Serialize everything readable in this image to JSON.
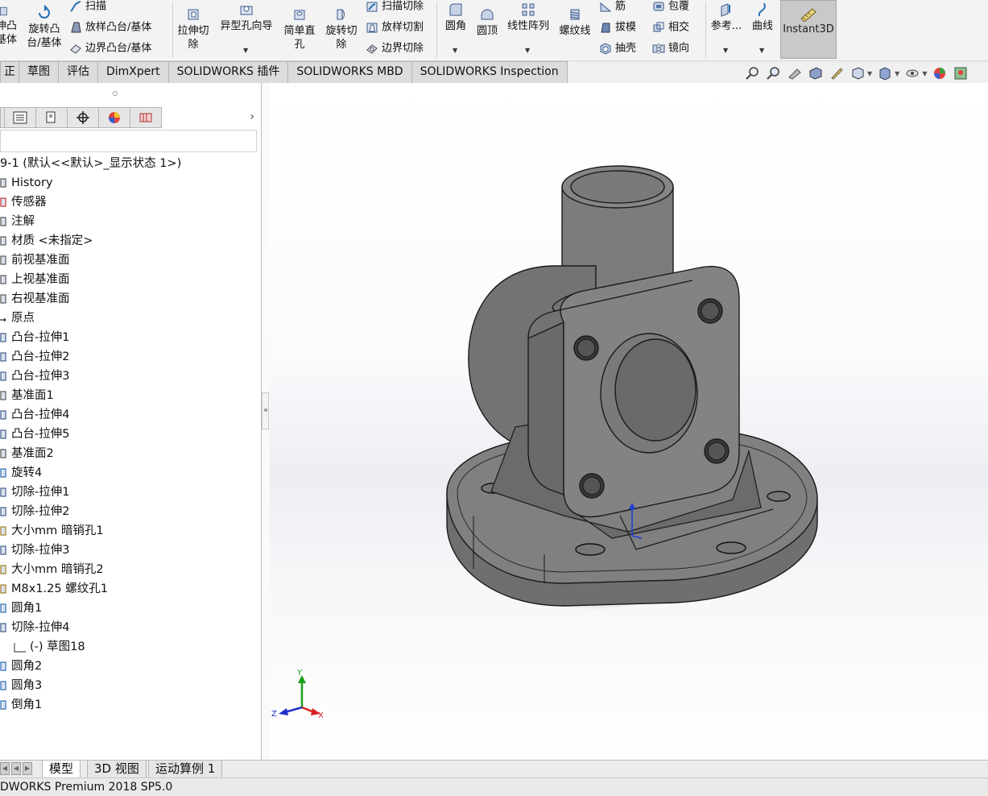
{
  "ribbon": {
    "col1": [
      "伸凸",
      "基体"
    ],
    "revolve_boss": [
      "旋转凸",
      "台/基体"
    ],
    "sweep": "扫描",
    "loft_boss": "放样凸台/基体",
    "boundary_boss": "边界凸台/基体",
    "extruded_cut": [
      "拉伸切",
      "除"
    ],
    "hole_wizard": "异型孔向导",
    "simple_hole": [
      "简单直",
      "孔"
    ],
    "revolved_cut": [
      "旋转切",
      "除"
    ],
    "swept_cut": "扫描切除",
    "lofted_cut": "放样切割",
    "boundary_cut": "边界切除",
    "fillet": "圆角",
    "dome": "圆顶",
    "linear_pattern": "线性阵列",
    "thread": "螺纹线",
    "rib": "筋",
    "draft": "拔模",
    "shell": "抽壳",
    "wrap": "包覆",
    "intersect": "相交",
    "mirror": "镜向",
    "reference": "参考...",
    "curves": "曲线",
    "instant3d": "Instant3D"
  },
  "tabs": [
    "正",
    "草图",
    "评估",
    "DimXpert",
    "SOLIDWORKS 插件",
    "SOLIDWORKS MBD",
    "SOLIDWORKS Inspection"
  ],
  "tree": {
    "root": "9-1  (默认<<默认>_显示状态 1>)",
    "items": [
      {
        "label": "History",
        "icon": "history-icon"
      },
      {
        "label": "传感器",
        "icon": "sensor-icon"
      },
      {
        "label": "注解",
        "icon": "annotation-icon"
      },
      {
        "label": "材质 <未指定>",
        "icon": "material-icon"
      },
      {
        "label": "前视基准面",
        "icon": "plane-icon"
      },
      {
        "label": "上视基准面",
        "icon": "plane-icon"
      },
      {
        "label": "右视基准面",
        "icon": "plane-icon"
      },
      {
        "label": "原点",
        "icon": "origin-icon"
      },
      {
        "label": "凸台-拉伸1",
        "icon": "extrude-icon"
      },
      {
        "label": "凸台-拉伸2",
        "icon": "extrude-icon"
      },
      {
        "label": "凸台-拉伸3",
        "icon": "extrude-icon"
      },
      {
        "label": "基准面1",
        "icon": "plane-icon"
      },
      {
        "label": "凸台-拉伸4",
        "icon": "extrude-icon"
      },
      {
        "label": "凸台-拉伸5",
        "icon": "extrude-icon"
      },
      {
        "label": "基准面2",
        "icon": "plane-icon"
      },
      {
        "label": "旋转4",
        "icon": "revolve-icon"
      },
      {
        "label": "切除-拉伸1",
        "icon": "cut-extrude-icon"
      },
      {
        "label": "切除-拉伸2",
        "icon": "cut-extrude-icon"
      },
      {
        "label": "大小mm 暗销孔1",
        "icon": "hole-wizard-icon"
      },
      {
        "label": "切除-拉伸3",
        "icon": "cut-extrude-icon"
      },
      {
        "label": "大小mm 暗销孔2",
        "icon": "hole-wizard-icon"
      },
      {
        "label": "M8x1.25 螺纹孔1",
        "icon": "hole-wizard-icon"
      },
      {
        "label": "圆角1",
        "icon": "fillet-icon"
      },
      {
        "label": "切除-拉伸4",
        "icon": "cut-extrude-icon"
      },
      {
        "label": "(-) 草图18",
        "icon": "sketch-icon",
        "sub": true
      },
      {
        "label": "圆角2",
        "icon": "fillet-icon"
      },
      {
        "label": "圆角3",
        "icon": "fillet-icon"
      },
      {
        "label": "倒角1",
        "icon": "chamfer-icon"
      }
    ]
  },
  "triad": {
    "y": "Y",
    "z": "Z",
    "x": "X"
  },
  "bottom_tabs": [
    "模型",
    "3D 视图",
    "运动算例 1"
  ],
  "status": "DWORKS Premium 2018 SP5.0",
  "colors": {
    "part": "#7a7a7a",
    "edge": "#1a1a1a",
    "rollback": "#3a7fd1",
    "axis_y": "#1aa01a",
    "axis_x": "#d92020",
    "axis_z": "#2030c8"
  }
}
